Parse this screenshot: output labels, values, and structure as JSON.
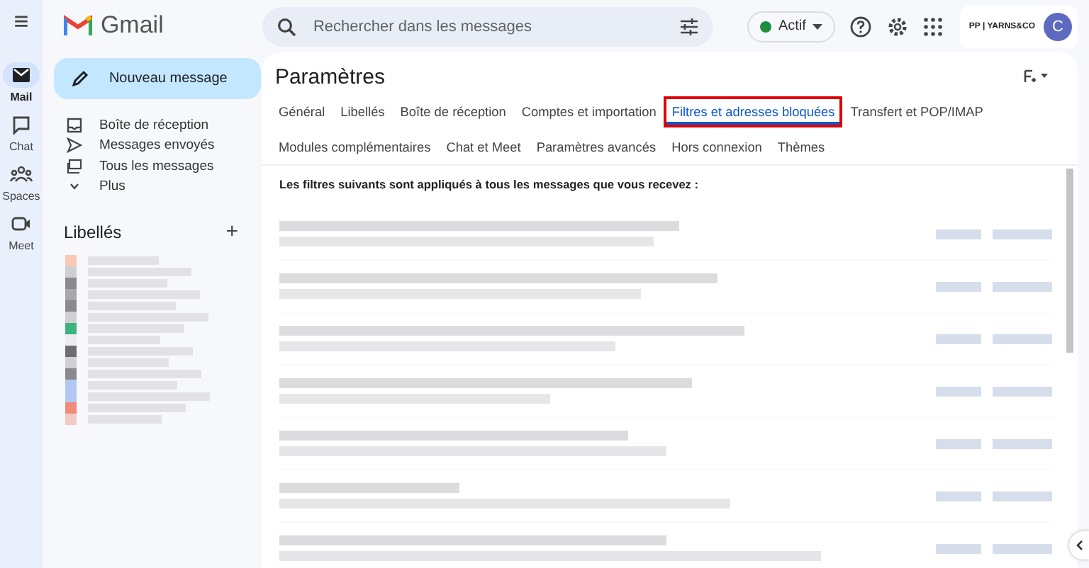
{
  "app": {
    "name": "Gmail",
    "menu_glyph": "≡"
  },
  "rail": [
    {
      "label": "Mail",
      "selected": true
    },
    {
      "label": "Chat",
      "selected": false
    },
    {
      "label": "Spaces",
      "selected": false
    },
    {
      "label": "Meet",
      "selected": false
    }
  ],
  "search": {
    "placeholder": "Rechercher dans les messages"
  },
  "status": {
    "label": "Actif",
    "color": "#1e8e3e"
  },
  "account": {
    "org": "PP | YARNS&CO",
    "avatar": "C"
  },
  "compose": {
    "label": "Nouveau message"
  },
  "nav": [
    {
      "label": "Boîte de réception"
    },
    {
      "label": "Messages envoyés"
    },
    {
      "label": "Tous les messages"
    },
    {
      "label": "Plus"
    }
  ],
  "labels": {
    "title": "Libellés",
    "add": "+",
    "items": [
      {
        "color": "#f8c9b5"
      },
      {
        "color": "#d0d0d4"
      },
      {
        "color": "#8a8a8e"
      },
      {
        "color": "#a8a8ac"
      },
      {
        "color": "#8a8a8e"
      },
      {
        "color": "#d0d0d4"
      },
      {
        "color": "#3fb37f"
      },
      {
        "color": "#ececef"
      },
      {
        "color": "#6e6e72"
      },
      {
        "color": "#d0d0d4"
      },
      {
        "color": "#8a8a8e"
      },
      {
        "color": "#b3c8f0"
      },
      {
        "color": "#b3c8f0"
      },
      {
        "color": "#f28b7a"
      },
      {
        "color": "#f4cac4"
      }
    ]
  },
  "settings": {
    "title": "Paramètres",
    "tab_rows": [
      [
        {
          "label": "Général",
          "selected": false,
          "highlighted": false
        },
        {
          "label": "Libellés",
          "selected": false,
          "highlighted": false
        },
        {
          "label": "Boîte de réception",
          "selected": false,
          "highlighted": false
        },
        {
          "label": "Comptes et importation",
          "selected": false,
          "highlighted": false
        },
        {
          "label": "Filtres et adresses bloquées",
          "selected": true,
          "highlighted": true
        },
        {
          "label": "Transfert et POP/IMAP",
          "selected": false,
          "highlighted": false
        }
      ],
      [
        {
          "label": "Modules complémentaires",
          "selected": false,
          "highlighted": false
        },
        {
          "label": "Chat et Meet",
          "selected": false,
          "highlighted": false
        },
        {
          "label": "Paramètres avancés",
          "selected": false,
          "highlighted": false
        },
        {
          "label": "Hors connexion",
          "selected": false,
          "highlighted": false
        },
        {
          "label": "Thèmes",
          "selected": false,
          "highlighted": false
        }
      ]
    ],
    "intro": "Les filtres suivants sont appliqués à tous les messages que vous recevez :"
  }
}
